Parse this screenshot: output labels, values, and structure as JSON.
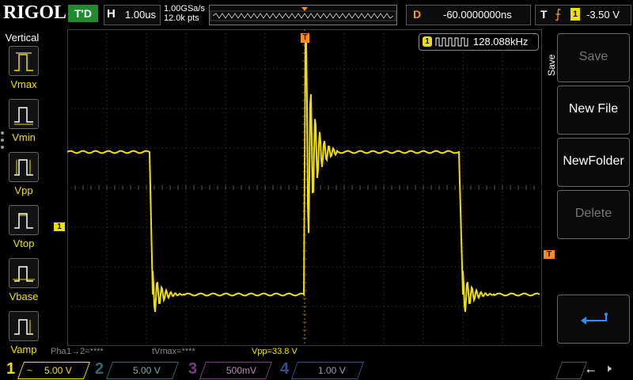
{
  "top": {
    "logo": "RIGOL",
    "trigger_status": "T'D",
    "horizontal_label": "H",
    "timebase": "1.00us",
    "sample_rate": "1.00GSa/s",
    "memory_depth": "12.0k pts",
    "delay_label": "D",
    "delay_value": "-60.0000000ns",
    "trigger_label": "T",
    "trigger_source": "1",
    "trigger_level": "-3.50 V"
  },
  "left_panel": {
    "title": "Vertical",
    "items": [
      {
        "label": "Vmax",
        "icon": "vmax-icon"
      },
      {
        "label": "Vmin",
        "icon": "vmin-icon"
      },
      {
        "label": "Vpp",
        "icon": "vpp-icon"
      },
      {
        "label": "Vtop",
        "icon": "vtop-icon"
      },
      {
        "label": "Vbase",
        "icon": "vbase-icon"
      },
      {
        "label": "Vamp",
        "icon": "vamp-icon"
      }
    ]
  },
  "scope": {
    "channel_marker": "1",
    "trigger_marker": "T",
    "top_marker": "T",
    "frequency_channel": "1",
    "frequency": "128.088kHz"
  },
  "right_panel": {
    "title": "Save",
    "buttons": [
      {
        "label": "Save",
        "enabled": false
      },
      {
        "label": "New File",
        "enabled": true
      },
      {
        "label": "NewFolder",
        "enabled": true
      },
      {
        "label": "Delete",
        "enabled": false
      },
      {
        "label": "",
        "icon": "enter-icon",
        "enabled": true
      }
    ]
  },
  "measurements": {
    "phase": "Pha",
    "phase_value": "1→2=****",
    "tvmax": "tVmax=****",
    "vpp": "Vpp=33.8 V"
  },
  "channels": [
    {
      "num": "1",
      "coupling": "~",
      "scale": "5.00 V",
      "color": "#f0e000",
      "active": true
    },
    {
      "num": "2",
      "coupling": "",
      "scale": "5.00 V",
      "color": "#00c8d8",
      "active": false
    },
    {
      "num": "3",
      "coupling": "",
      "scale": "500mV",
      "color": "#e040ff",
      "active": false
    },
    {
      "num": "4",
      "coupling": "",
      "scale": "1.00 V",
      "color": "#3a6cff",
      "active": false
    }
  ],
  "colors": {
    "ch1": "#f0e000",
    "trigger": "#ff8a1f",
    "triggered_badge": "#1f8a2e"
  }
}
